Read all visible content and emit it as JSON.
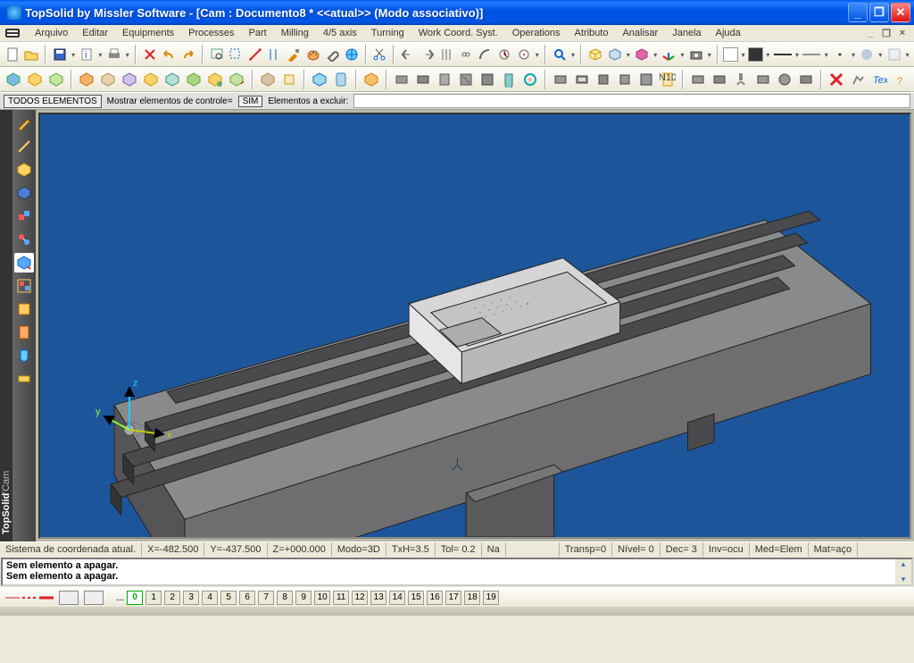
{
  "titlebar": {
    "text": "TopSolid by Missler Software - [Cam : Documento8 *  <<atual>>  (Modo associativo)]"
  },
  "menu": {
    "items": [
      "Arquivo",
      "Editar",
      "Equipments",
      "Processes",
      "Part",
      "Milling",
      "4/5 axis",
      "Turning",
      "Work Coord. Syst.",
      "Operations",
      "Atributo",
      "Analisar",
      "Janela",
      "Ajuda"
    ]
  },
  "filter": {
    "all": "TODOS ELEMENTOS",
    "showLabel": "Mostrar elementos de controle=",
    "sim": "SIM",
    "excludeLabel": "Elementos a excluir:"
  },
  "sidebar": {
    "product": "TopSolid",
    "module": "'Cam"
  },
  "status": {
    "coord_sys": "Sistema de coordenada atual.",
    "x": "X=-482.500",
    "y": "Y=-437.500",
    "z": "Z=+000.000",
    "mode": "Modo=3D",
    "txh": "TxH=3.5",
    "tol": "Tol=    0.2",
    "na": "Na",
    "transp": "Transp=0",
    "nivel": "Nível= 0",
    "dec": "Dec= 3",
    "inv": "Inv=ocu",
    "med": "Med=Elem",
    "mat": "Mat=aço"
  },
  "messages": {
    "line1": "Sem elemento a apagar.",
    "line2": "Sem elemento a apagar."
  },
  "layers": {
    "sep": "...",
    "nums": [
      "0",
      "1",
      "2",
      "3",
      "4",
      "5",
      "6",
      "7",
      "8",
      "9",
      "10",
      "11",
      "12",
      "13",
      "14",
      "15",
      "16",
      "17",
      "18",
      "19"
    ]
  },
  "axes": {
    "x": "x",
    "y": "y",
    "z": "z"
  },
  "colors": {
    "titlebar": "#0054e3",
    "viewport": "#1d559b",
    "steel_top": "#9a9a9c",
    "steel_front": "#6e6e70",
    "steel_side": "#555557",
    "part_top": "#d6d6d8",
    "part_front": "#b8b8ba",
    "part_side": "#e6e6e8"
  }
}
